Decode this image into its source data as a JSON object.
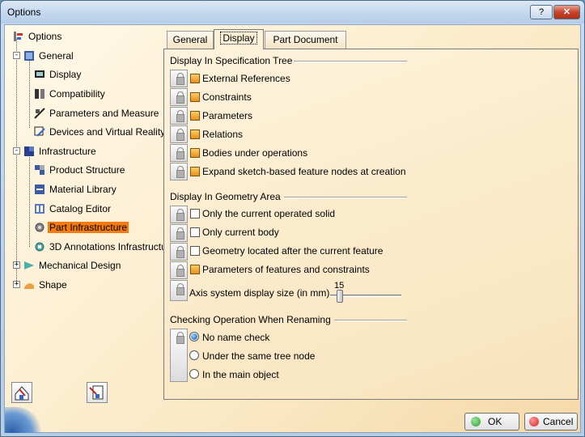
{
  "window": {
    "title": "Options",
    "help_label": "?",
    "close_label": "✕"
  },
  "tree": {
    "root": {
      "label": "Options",
      "icon": "options-tree-icon"
    },
    "items": [
      {
        "label": "General",
        "icon": "general-icon",
        "expanded": true
      },
      {
        "label": "Display",
        "icon": "display-icon"
      },
      {
        "label": "Compatibility",
        "icon": "compatibility-icon"
      },
      {
        "label": "Parameters and Measure",
        "icon": "parameters-measure-icon"
      },
      {
        "label": "Devices and Virtual Reality",
        "icon": "devices-icon"
      },
      {
        "label": "Infrastructure",
        "icon": "infrastructure-icon",
        "expanded": true
      },
      {
        "label": "Product Structure",
        "icon": "product-structure-icon"
      },
      {
        "label": "Material Library",
        "icon": "material-library-icon"
      },
      {
        "label": "Catalog Editor",
        "icon": "catalog-editor-icon"
      },
      {
        "label": "Part Infrastructure",
        "icon": "part-infrastructure-icon",
        "selected": true
      },
      {
        "label": "3D Annotations Infrastructu",
        "icon": "annotations-icon"
      },
      {
        "label": "Mechanical Design",
        "icon": "mechanical-design-icon",
        "expanded": false
      },
      {
        "label": "Shape",
        "icon": "shape-icon",
        "expanded": false
      }
    ]
  },
  "tabs": [
    {
      "label": "General",
      "active": false
    },
    {
      "label": "Display",
      "active": true
    },
    {
      "label": "Part Document",
      "active": false
    }
  ],
  "spec_tree": {
    "title": "Display In Specification Tree",
    "options": [
      {
        "label": "External References",
        "checked": true
      },
      {
        "label": "Constraints",
        "checked": true
      },
      {
        "label": "Parameters",
        "checked": true
      },
      {
        "label": "Relations",
        "checked": true
      },
      {
        "label": "Bodies under operations",
        "checked": true
      },
      {
        "label": "Expand sketch-based feature nodes at creation",
        "checked": true
      }
    ]
  },
  "geometry_area": {
    "title": "Display In Geometry Area",
    "options": [
      {
        "label": "Only the current operated solid",
        "checked": false
      },
      {
        "label": "Only current body",
        "checked": false
      },
      {
        "label": "Geometry located after the current feature",
        "checked": false
      },
      {
        "label": "Parameters of features and constraints",
        "checked": true
      }
    ],
    "axis_label": "Axis system display size (in mm)",
    "axis_value": "15"
  },
  "renaming": {
    "title": "Checking Operation When Renaming",
    "options": [
      {
        "label": "No name check",
        "selected": true
      },
      {
        "label": "Under the same tree node",
        "selected": false
      },
      {
        "label": "In the main object",
        "selected": false
      }
    ]
  },
  "buttons": {
    "ok_label": "OK",
    "cancel_label": "Cancel"
  },
  "colors": {
    "selected_highlight": "#f47b0c",
    "checkbox_on": "#f0a030",
    "ok_dot": "#2e9e2e",
    "cancel_dot": "#d42020"
  }
}
